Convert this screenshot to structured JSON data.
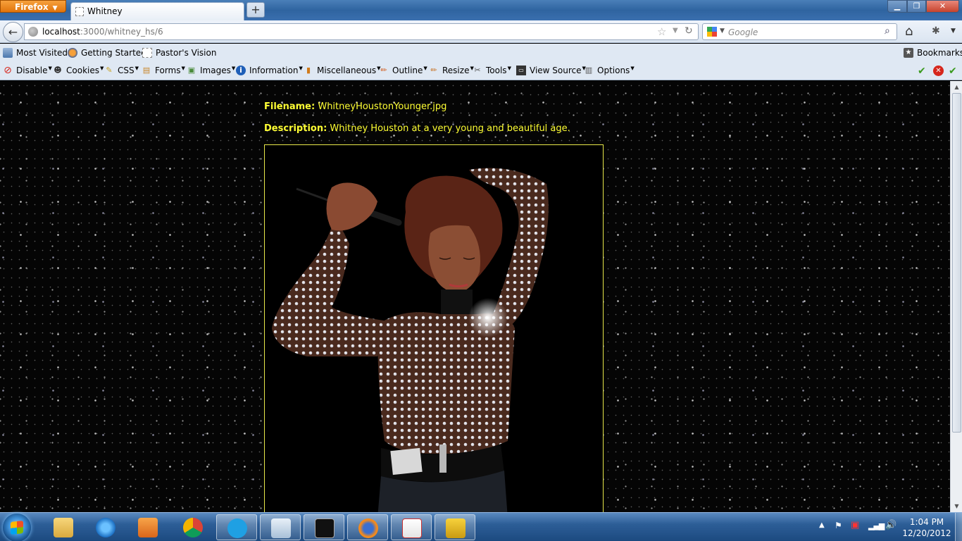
{
  "browser": {
    "app_button": "Firefox",
    "tab_title": "Whitney",
    "new_tab": "+",
    "url_host": "localhost",
    "url_path": ":3000/whitney_hs/6",
    "search_placeholder": "Google",
    "window_controls": [
      "minimize-icon",
      "maximize-icon",
      "close-icon"
    ]
  },
  "bookmarks": {
    "items": [
      "Most Visited",
      "Getting Started",
      "Pastor's Vision"
    ],
    "menu": "Bookmarks"
  },
  "devtoolbar": {
    "items": [
      {
        "label": "Disable",
        "icon": "disable-icon",
        "color": "#d6261c"
      },
      {
        "label": "Cookies",
        "icon": "cookies-icon",
        "color": "#333333"
      },
      {
        "label": "CSS",
        "icon": "css-icon",
        "color": "#c9a227"
      },
      {
        "label": "Forms",
        "icon": "forms-icon",
        "color": "#c8862a"
      },
      {
        "label": "Images",
        "icon": "images-icon",
        "color": "#4a8a3a"
      },
      {
        "label": "Information",
        "icon": "information-icon",
        "color": "#1f5fb8"
      },
      {
        "label": "Miscellaneous",
        "icon": "miscellaneous-icon",
        "color": "#d07a1a"
      },
      {
        "label": "Outline",
        "icon": "outline-icon",
        "color": "#d35a1a"
      },
      {
        "label": "Resize",
        "icon": "resize-icon",
        "color": "#c76f1f"
      },
      {
        "label": "Tools",
        "icon": "tools-icon",
        "color": "#555555"
      },
      {
        "label": "View Source",
        "icon": "view-source-icon",
        "color": "#333333"
      },
      {
        "label": "Options",
        "icon": "options-icon",
        "color": "#555555"
      }
    ]
  },
  "page": {
    "filename_label": "Filename:",
    "filename_value": "WhitneyHoustonYounger.jpg",
    "description_label": "Description:",
    "description_value": "Whitney Houston at a very young and beautiful age.",
    "text_color": "#ffff33",
    "photo_border_color": "#e8e84a"
  },
  "taskbar": {
    "apps": [
      "explorer",
      "internet-explorer",
      "media-player",
      "chrome",
      "skype",
      "notepad",
      "cmd",
      "firefox",
      "acrobat",
      "fireworks"
    ],
    "time": "1:04 PM",
    "date": "12/20/2012"
  }
}
